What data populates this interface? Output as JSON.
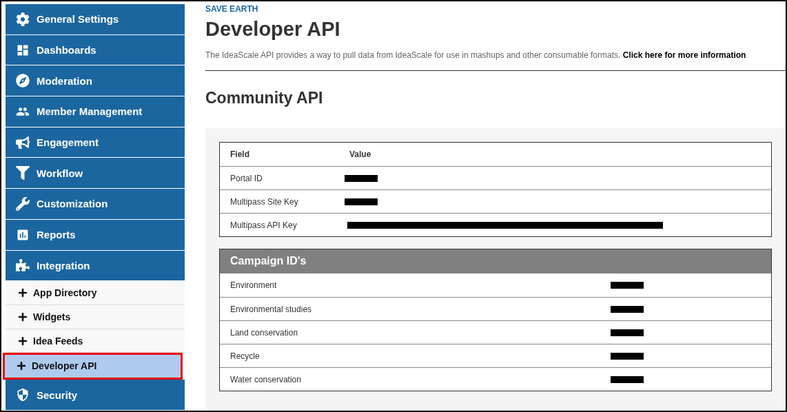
{
  "sidebar": {
    "items": [
      {
        "kind": "section",
        "label": "General Settings",
        "selected": false
      },
      {
        "kind": "section",
        "label": "Dashboards",
        "selected": false
      },
      {
        "kind": "section",
        "label": "Moderation",
        "selected": false
      },
      {
        "kind": "section",
        "label": "Member Management",
        "selected": false
      },
      {
        "kind": "section",
        "label": "Engagement",
        "selected": false
      },
      {
        "kind": "section",
        "label": "Workflow",
        "selected": false
      },
      {
        "kind": "section",
        "label": "Customization",
        "selected": false
      },
      {
        "kind": "section",
        "label": "Reports",
        "selected": false
      },
      {
        "kind": "section",
        "label": "Integration",
        "selected": false
      },
      {
        "kind": "subitem",
        "label": "App Directory",
        "selected": false
      },
      {
        "kind": "subitem",
        "label": "Widgets",
        "selected": false
      },
      {
        "kind": "subitem",
        "label": "Idea Feeds",
        "selected": false
      },
      {
        "kind": "subitem",
        "label": "Developer API",
        "selected": true
      },
      {
        "kind": "section",
        "label": "Security",
        "selected": false
      }
    ]
  },
  "breadcrumb": "SAVE EARTH",
  "title": "Developer API",
  "description": {
    "text": "The IdeaScale API provides a way to pull data from IdeaScale for use in mashups and other consumable formats.",
    "link": "Click here for more information"
  },
  "community_api": {
    "heading": "Community API",
    "columns": [
      "Field",
      "Value"
    ],
    "rows": [
      {
        "field": "Portal ID",
        "kind": "short"
      },
      {
        "field": "Multipass Site Key",
        "kind": "short"
      },
      {
        "field": "Multipass API Key",
        "kind": "long"
      }
    ]
  },
  "campaigns": {
    "heading": "Campaign ID's",
    "rows": [
      {
        "name": "Environment",
        "kind": "short"
      },
      {
        "name": "Environmental studies",
        "kind": "short"
      },
      {
        "name": "Land conservation",
        "kind": "short"
      },
      {
        "name": "Recycle",
        "kind": "short"
      },
      {
        "name": "Water conservation",
        "kind": "short"
      }
    ]
  }
}
